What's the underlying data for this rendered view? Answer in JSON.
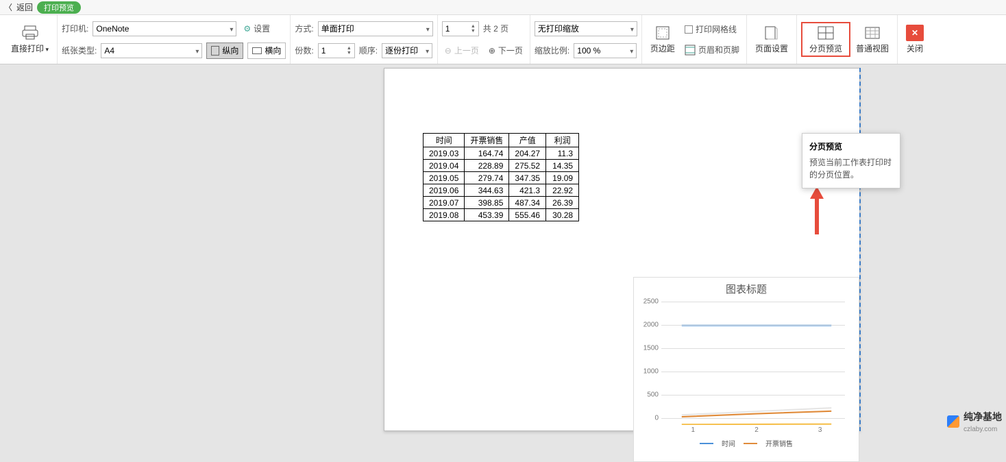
{
  "topbar": {
    "back": "返回",
    "pill": "打印预览"
  },
  "group_print": {
    "direct_print": "直接打印"
  },
  "group_printer": {
    "printer_label": "打印机:",
    "printer_value": "OneNote",
    "settings": "设置",
    "paper_label": "纸张类型:",
    "paper_value": "A4",
    "portrait": "纵向",
    "landscape": "横向"
  },
  "group_mode": {
    "mode_label": "方式:",
    "mode_value": "单面打印",
    "copies_label": "份数:",
    "copies_value": "1",
    "order_label": "顺序:",
    "order_value": "逐份打印"
  },
  "group_page": {
    "page_value": "1",
    "total": "共 2 页",
    "prev": "上一页",
    "next": "下一页"
  },
  "group_zoom": {
    "zoom_mode": "无打印缩放",
    "zoom_label": "缩放比例:",
    "zoom_value": "100 %"
  },
  "group_margin": {
    "margin": "页边距",
    "gridlines": "打印网格线",
    "headerfooter": "页眉和页脚"
  },
  "group_setup": {
    "page_setup": "页面设置"
  },
  "group_view": {
    "page_break": "分页预览",
    "normal": "普通视图"
  },
  "group_close": {
    "close": "关闭"
  },
  "tooltip": {
    "title": "分页预览",
    "body": "预览当前工作表打印时的分页位置。"
  },
  "table": {
    "headers": [
      "时间",
      "开票销售",
      "产值",
      "利润"
    ],
    "rows": [
      [
        "2019.03",
        "164.74",
        "204.27",
        "11.3"
      ],
      [
        "2019.04",
        "228.89",
        "275.52",
        "14.35"
      ],
      [
        "2019.05",
        "279.74",
        "347.35",
        "19.09"
      ],
      [
        "2019.06",
        "344.63",
        "421.3",
        "22.92"
      ],
      [
        "2019.07",
        "398.85",
        "487.34",
        "26.39"
      ],
      [
        "2019.08",
        "453.39",
        "555.46",
        "30.28"
      ]
    ]
  },
  "chart_data": {
    "type": "line",
    "title": "图表标题",
    "categories": [
      "1",
      "2",
      "3"
    ],
    "ylim": [
      0,
      2500
    ],
    "yticks": [
      0,
      500,
      1000,
      1500,
      2000,
      2500
    ],
    "series": [
      {
        "name": "时间",
        "color": "#4a90d9",
        "values": [
          2019,
          2019,
          2019
        ]
      },
      {
        "name": "开票销售",
        "color": "#e08b3a",
        "values": [
          165,
          229,
          280
        ]
      }
    ],
    "extra_series_visible": [
      {
        "color": "#e6e6e6",
        "values": [
          204,
          276,
          347
        ]
      },
      {
        "color": "#f6c04d",
        "values": [
          11,
          14,
          19
        ]
      }
    ]
  },
  "watermark": {
    "main": "纯净基地",
    "sub": "czlaby.com"
  }
}
